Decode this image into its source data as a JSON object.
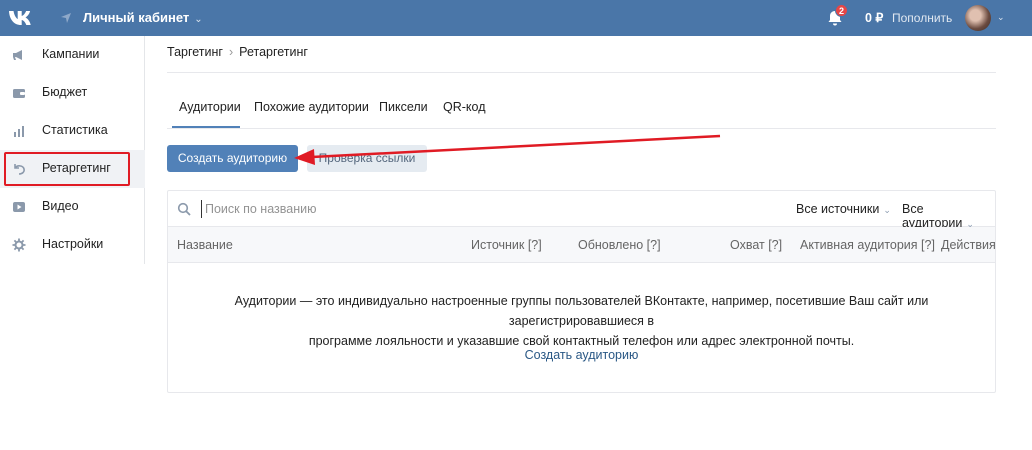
{
  "topbar": {
    "title": "Личный кабинет",
    "notifications_count": "2",
    "balance": "0 ₽",
    "topup_label": "Пополнить"
  },
  "sidebar": {
    "items": [
      {
        "label": "Кампании",
        "icon": "megaphone-icon"
      },
      {
        "label": "Бюджет",
        "icon": "wallet-icon"
      },
      {
        "label": "Статистика",
        "icon": "stats-icon"
      },
      {
        "label": "Ретаргетинг",
        "icon": "retarget-icon",
        "active": true
      },
      {
        "label": "Видео",
        "icon": "play-icon"
      },
      {
        "label": "Настройки",
        "icon": "gear-icon"
      }
    ]
  },
  "breadcrumb": {
    "parent": "Таргетинг",
    "current": "Ретаргетинг"
  },
  "tabs": [
    {
      "label": "Аудитории",
      "active": true
    },
    {
      "label": "Похожие аудитории"
    },
    {
      "label": "Пиксели"
    },
    {
      "label": "QR-код"
    }
  ],
  "actions": {
    "create_label": "Создать аудиторию",
    "check_link_label": "Проверка ссылки"
  },
  "search": {
    "placeholder": "Поиск по названию"
  },
  "filters": {
    "sources": "Все источники",
    "audiences": "Все аудитории"
  },
  "table": {
    "columns": [
      "Название",
      "Источник [?]",
      "Обновлено [?]",
      "Охват [?]",
      "Активная аудитория [?]",
      "Действия"
    ]
  },
  "empty_state": {
    "line1": "Аудитории — это индивидуально настроенные группы пользователей ВКонтакте, например, посетившие Ваш сайт или зарегистрировавшиеся в",
    "line2": "программе лояльности и указавшие свой контактный телефон или адрес электронной почты.",
    "link": "Создать аудиторию"
  },
  "colors": {
    "header": "#4a76a8",
    "primary": "#5181b8",
    "annotation": "#e01b24"
  }
}
